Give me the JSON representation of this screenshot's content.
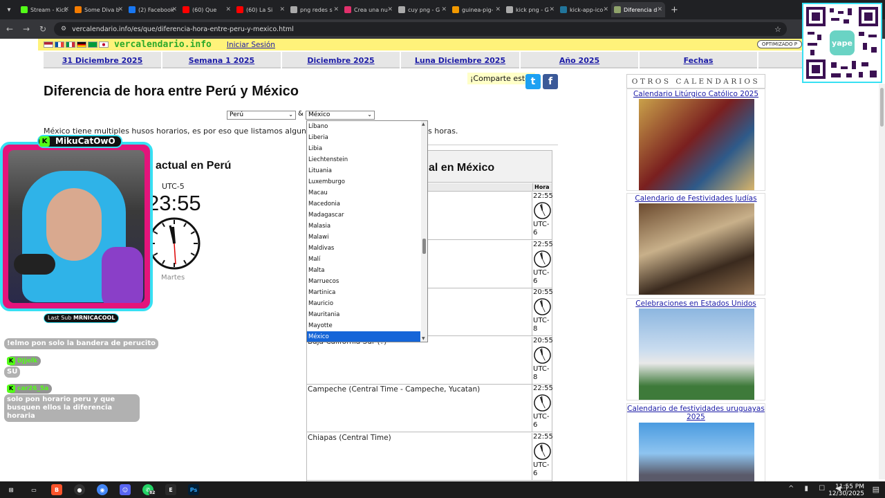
{
  "browser": {
    "tabs": [
      {
        "label": "Stream - Kick",
        "color": "#53fc18",
        "active": false
      },
      {
        "label": "Some Diva b",
        "color": "#f57c00",
        "active": false
      },
      {
        "label": "(2) Facebook",
        "color": "#1877f2",
        "active": false
      },
      {
        "label": "(60) Que",
        "color": "#ff0000",
        "active": false
      },
      {
        "label": "(60) La Si",
        "color": "#ff0000",
        "active": false
      },
      {
        "label": "png redes s",
        "color": "#aaaaaa",
        "active": false
      },
      {
        "label": "Crea una nu",
        "color": "#e1306c",
        "active": false
      },
      {
        "label": "cuy png - G",
        "color": "#aaaaaa",
        "active": false
      },
      {
        "label": "guinea-pig-",
        "color": "#f29900",
        "active": false
      },
      {
        "label": "kick png - G",
        "color": "#aaaaaa",
        "active": false
      },
      {
        "label": "kick-app-ico",
        "color": "#21759b",
        "active": false
      },
      {
        "label": "Diferencia d",
        "color": "#8fa36b",
        "active": true
      }
    ],
    "url": "vercalendario.info/es/que/diferencia-hora-entre-peru-y-mexico.html"
  },
  "site": {
    "brand": "vercalendario.info",
    "login": "Iniciar Sesión",
    "optimized": "OPTIMIZADO P",
    "menu": [
      "31 Diciembre 2025",
      "Semana 1 2025",
      "Diciembre 2025",
      "Luna Diciembre 2025",
      "Año 2025",
      "Fechas"
    ],
    "share_label": "¡Comparte esto!",
    "title": "Diferencia de hora entre Perú y México",
    "select_from": "Perú",
    "amp": "&",
    "select_to": "México",
    "intro_left": "México tiene multiples husos horarios, es por eso que listamos algunos de los",
    "intro_right": "s horas.",
    "peru_heading": "actual en Perú",
    "peru_utc": "UTC-5",
    "peru_time": "23:55",
    "peru_day": "Martes",
    "mexico_heading": "al en México",
    "col_hora": "Hora",
    "mexico_rows": [
      {
        "name": "",
        "time": "22:55",
        "utc": "UTC-6"
      },
      {
        "name": "",
        "time": "22:55",
        "utc": "UTC-6"
      },
      {
        "name": "ja California)",
        "time": "20:55",
        "utc": "UTC-8"
      },
      {
        "name": "Baja California Sur (?)",
        "time": "20:55",
        "utc": "UTC-8"
      },
      {
        "name": "Campeche (Central Time - Campeche, Yucatan)",
        "time": "22:55",
        "utc": "UTC-6"
      },
      {
        "name": "Chiapas (Central Time)",
        "time": "22:55",
        "utc": "UTC-6"
      }
    ],
    "dropdown_options": [
      "Líbano",
      "Liberia",
      "Libia",
      "Liechtenstein",
      "Lituania",
      "Luxemburgo",
      "Macau",
      "Macedonia",
      "Madagascar",
      "Malasia",
      "Malawi",
      "Maldivas",
      "Malí",
      "Malta",
      "Marruecos",
      "Martinica",
      "Mauricio",
      "Mauritania",
      "Mayotte",
      "México"
    ],
    "dropdown_selected": "México",
    "sidebar": {
      "heading": "OTROS CALENDARIOS",
      "items": [
        {
          "label": "Calendario Litúrgico Católico 2025"
        },
        {
          "label": "Calendario de Festividades Judías 2025"
        },
        {
          "label": "Celebraciones en Estados Unidos 2025"
        },
        {
          "label": "Calendario de festividades uruguayas 2025"
        }
      ]
    }
  },
  "stream": {
    "streamer": "MikuCatOwO",
    "last_sub_label": "Last Sub",
    "last_sub_user": "MRNICACOOL",
    "chat": [
      {
        "user": "",
        "text": "!elmo pon solo la bandera de perucito"
      },
      {
        "user": "DJjelk",
        "text": "SU"
      },
      {
        "user": "car26_5a",
        "text": "solo pon horario peru y que busquen ellos la diferencia horaria"
      }
    ]
  },
  "taskbar": {
    "time": "11:55 PM",
    "date": "12/30/2025",
    "whatsapp_badge": "82"
  }
}
